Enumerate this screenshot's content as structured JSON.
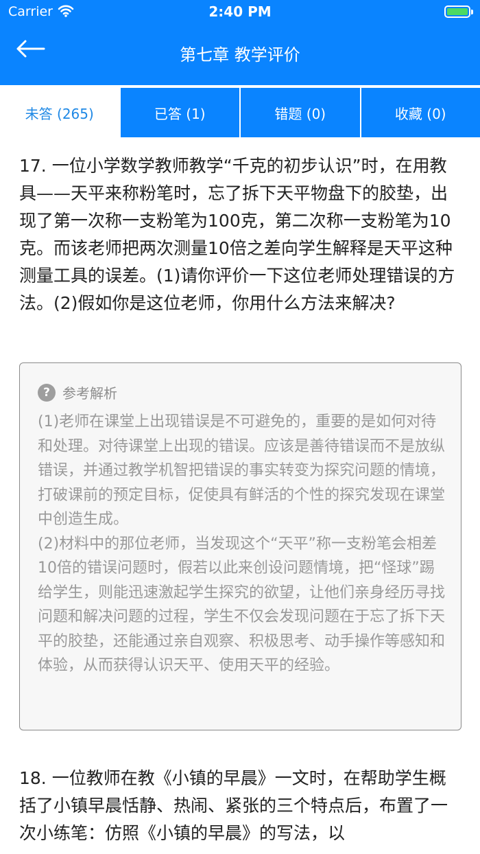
{
  "status_bar": {
    "carrier": "Carrier",
    "time": "2:40 PM"
  },
  "nav": {
    "title": "第七章 教学评价",
    "back_icon": "arrow-left-icon"
  },
  "tabs": [
    {
      "label": "未答 (265)",
      "active": true
    },
    {
      "label": "已答 (1)",
      "active": false
    },
    {
      "label": "错题 (0)",
      "active": false
    },
    {
      "label": "收藏 (0)",
      "active": false
    }
  ],
  "questions": [
    {
      "text": "17. 一位小学数学教师教学“千克的初步认识”时，在用教具——天平来称粉笔时，忘了拆下天平物盘下的胶垫，出现了第一次称一支粉笔为100克，第二次称一支粉笔为10克。而该老师把两次测量10倍之差向学生解释是天平这种测量工具的误差。(1)请你评价一下这位老师处理错误的方法。(2)假如你是这位老师，你用什么方法来解决?",
      "answer_label": "参考解析",
      "answer_text": "(1)老师在课堂上出现错误是不可避免的，重要的是如何对待和处理。对待课堂上出现的错误。应该是善待错误而不是放纵错误，并通过教学机智把错误的事实转变为探究问题的情境，打破课前的预定目标，促使具有鲜活的个性的探究发现在课堂中创造生成。\n(2)材料中的那位老师，当发现这个“天平”称一支粉笔会相差10倍的错误问题时，假若以此来创设问题情境，把“怪球”踢给学生，则能迅速激起学生探究的欲望，让他们亲身经历寻找问题和解决问题的过程，学生不仅会发现问题在于忘了拆下天平的胶垫，还能通过亲自观察、积极思考、动手操作等感知和体验，从而获得认识天平、使用天平的经验。"
    },
    {
      "text": "18. 一位教师在教《小镇的早晨》一文时，在帮助学生概括了小镇早晨恬静、热闹、紧张的三个特点后，布置了一次小练笔：仿照《小镇的早晨》的写法，以"
    }
  ],
  "colors": {
    "primary": "#0a84ff",
    "active_tab_text": "#1e88e5",
    "answer_bg": "#f7f7f7",
    "answer_text": "#999999"
  }
}
